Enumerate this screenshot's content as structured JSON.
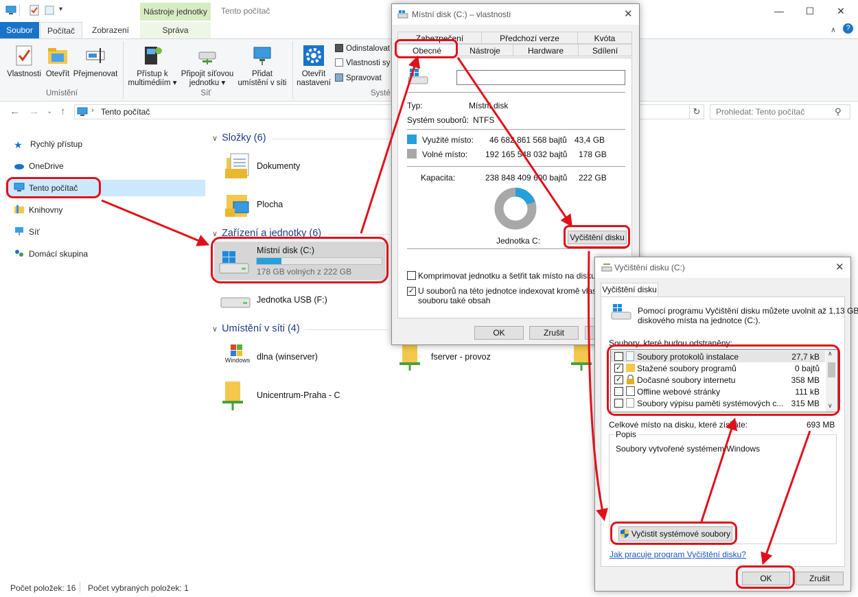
{
  "explorer": {
    "context_group": "Nástroje jednotky",
    "window_title": "Tento počítač",
    "tabs": [
      "Soubor",
      "Počítač",
      "Zobrazení",
      "Správa"
    ],
    "ribbon": {
      "location": {
        "label": "Umístění",
        "buttons": [
          "Vlastnosti",
          "Otevřít",
          "Přejmenovat"
        ]
      },
      "network": {
        "label": "Síť",
        "buttons": [
          {
            "line1": "Přístup k",
            "line2": "multimédiím ▾"
          },
          {
            "line1": "Připojit síťovou",
            "line2": "jednotku ▾"
          },
          {
            "line1": "Přidat",
            "line2": "umístění v síti"
          }
        ]
      },
      "system": {
        "label": "Systé",
        "open_settings": {
          "line1": "Otevřít",
          "line2": "nastavení"
        },
        "small": [
          "Odinstalovat",
          "Vlastnosti sy",
          "Spravovat"
        ]
      }
    },
    "address": "Tento počítač",
    "search_placeholder": "Prohledat: Tento počítač",
    "nav": [
      "Rychlý přístup",
      "OneDrive",
      "Tento počítač",
      "Knihovny",
      "Síť",
      "Domácí skupina"
    ],
    "groups": {
      "folders": "Složky (6)",
      "drives": "Zařízení a jednotky (6)",
      "network": "Umístění v síti (4)"
    },
    "folders": [
      "Dokumenty",
      "Plocha"
    ],
    "drives": {
      "c_name": "Místní disk (C:)",
      "c_free": "178 GB volných z 222 GB",
      "c_used_fraction": 0.196,
      "usb": "Jednotka USB (F:)"
    },
    "network_items": [
      "dlna (winserver)",
      "fserver - provoz",
      "Unicentrum-Praha  -  C"
    ],
    "wmp_logo": "Windows Media Player",
    "status": {
      "count": "Počet položek: 16",
      "selected": "Počet vybraných položek: 1"
    }
  },
  "props": {
    "title": "Místní disk (C:) – vlastnosti",
    "tabs_top": [
      "Zabezpečení",
      "Předchozí verze",
      "Kvóta"
    ],
    "tabs_bottom": [
      "Obecné",
      "Nástroje",
      "Hardware",
      "Sdílení"
    ],
    "type_label": "Typ:",
    "type_value": "Místní disk",
    "fs_label": "Systém souborů:",
    "fs_value": "NTFS",
    "used_label": "Využité místo:",
    "used_bytes": "46 682 861 568 bajtů",
    "used_gb": "43,4 GB",
    "free_label": "Volné místo:",
    "free_bytes": "192 165 548 032 bajtů",
    "free_gb": "178 GB",
    "cap_label": "Kapacita:",
    "cap_bytes": "238 848 409 600 bajtů",
    "cap_gb": "222 GB",
    "drive_label": "Jednotka C:",
    "cleanup_button": "Vyčištění disku",
    "compress": "Komprimovat jednotku a šetřit tak místo na disku",
    "index_line1": "U souborů na této jednotce indexovat kromě vlastnos",
    "index_line2": "souboru také obsah",
    "ok": "OK",
    "cancel": "Zrušit",
    "used_fraction": 0.196,
    "colors": {
      "used": "#26a0da",
      "free": "#a8a8a8"
    }
  },
  "cleanup": {
    "title": "Vyčištění disku  (C:)",
    "tab": "Vyčištění disku",
    "intro_line1": "Pomocí programu Vyčištění disku můžete uvolnit až 1,13 GB",
    "intro_line2": "diskového místa na jednotce  (C:).",
    "list_label": "Soubory, které budou odstraněny:",
    "items": [
      {
        "name": "Soubory protokolů instalace",
        "size": "27,7 kB",
        "checked": false
      },
      {
        "name": "Stažené soubory programů",
        "size": "0 bajtů",
        "checked": true
      },
      {
        "name": "Dočasné soubory internetu",
        "size": "358 MB",
        "checked": true
      },
      {
        "name": "Offline webové stránky",
        "size": "111 kB",
        "checked": false
      },
      {
        "name": "Soubory výpisu paměti systémových c...",
        "size": "315 MB",
        "checked": false
      }
    ],
    "total_label": "Celkové místo na disku, které získáte:",
    "total_value": "693 MB",
    "desc_label": "Popis",
    "desc_text": "Soubory vytvořené systémem Windows",
    "system_button": "Vyčistit systémové soubory",
    "help_link": "Jak pracuje program Vyčištění disku?",
    "ok": "OK",
    "cancel": "Zrušit"
  }
}
